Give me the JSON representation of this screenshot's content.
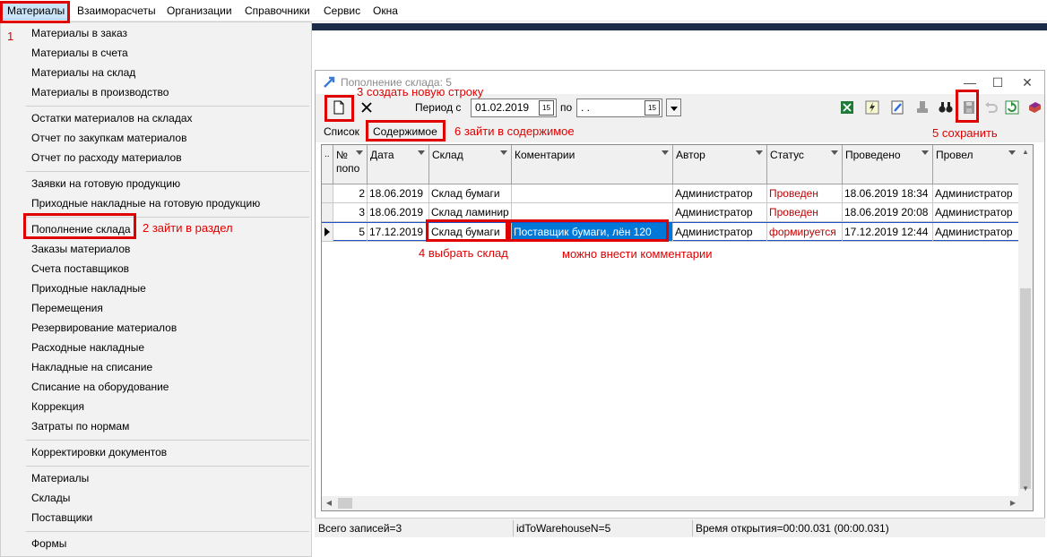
{
  "menubar": {
    "items": [
      "Материалы",
      "Взаиморасчеты",
      "Организации",
      "Справочники",
      "Сервис",
      "Окна"
    ]
  },
  "dropdown": {
    "items": [
      "Материалы в заказ",
      "Материалы в счета",
      "Материалы на склад",
      "Материалы в производство",
      "Остатки материалов на складах",
      "Отчет по закупкам материалов",
      "Отчет по расходу материалов",
      "Заявки на готовую продукцию",
      "Приходные накладные на готовую продукцию",
      "Пополнение склада",
      "Заказы материалов",
      "Счета поставщиков",
      "Приходные накладные",
      "Перемещения",
      "Резервирование материалов",
      "Расходные накладные",
      "Накладные на списание",
      "Списание на оборудование",
      "Коррекция",
      "Затраты по нормам",
      "Корректировки документов",
      "Материалы",
      "Склады",
      "Поставщики",
      "Формы"
    ]
  },
  "window": {
    "title": "Пополнение склада: 5",
    "period_label": "Период с",
    "period_from": "01.02.2019",
    "period_to_label": "по",
    "period_to": " .  .",
    "tabs": [
      "Список",
      "Содержимое"
    ]
  },
  "grid": {
    "columns": [
      "№ попо",
      "Дата",
      "Склад",
      "Коментарии",
      "Автор",
      "Статус",
      "Проведено",
      "Провел"
    ],
    "rows": [
      {
        "num": "2",
        "date": "18.06.2019",
        "warehouse": "Склад бумаги",
        "comment": "",
        "author": "Администратор",
        "status": "Проведен",
        "done": "18.06.2019 18:34",
        "by": "Администратор"
      },
      {
        "num": "3",
        "date": "18.06.2019",
        "warehouse": "Склад ламинир",
        "comment": "",
        "author": "Администратор",
        "status": "Проведен",
        "done": "18.06.2019 20:08",
        "by": "Администратор"
      },
      {
        "num": "5",
        "date": "17.12.2019",
        "warehouse": "Склад бумаги",
        "comment": "Поставщик бумаги, лён 120",
        "author": "Администратор",
        "status": "формируется",
        "done": "17.12.2019 12:44",
        "by": "Администратор"
      }
    ]
  },
  "statusbar": {
    "records": "Всего записей=3",
    "id": "idToWarehouseN=5",
    "time": "Время открытия=00:00.031 (00:00.031)"
  },
  "annotations": {
    "a1": "1",
    "a2": "2 зайти в раздел",
    "a3": "3  создать новую строку",
    "a4": "4  выбрать склад",
    "a5": "5 сохранить",
    "a6": "6  зайти в содержимое",
    "a7": "можно внести комментарии"
  },
  "colors": {
    "annotation": "#e00000",
    "selection": "#0078d7",
    "status_red": "#c00000"
  }
}
